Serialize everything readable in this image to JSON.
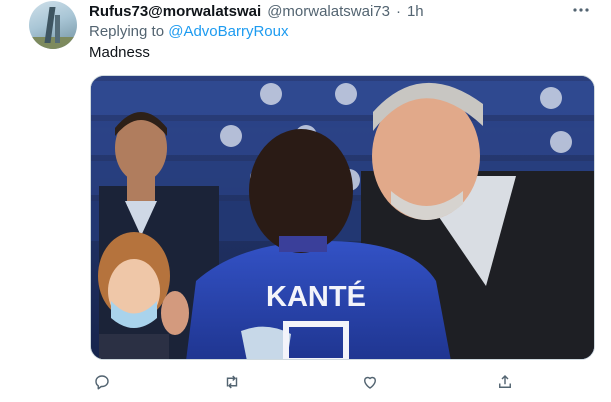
{
  "tweet": {
    "display_name": "Rufus73@morwalatswai",
    "handle": "@morwalatswai73",
    "separator": "·",
    "time": "1h",
    "replying_prefix": "Replying to",
    "replying_to": "@AdvoBarryRoux",
    "text": "Madness",
    "media_jersey_name": "KANTÉ"
  },
  "icons": {
    "more": "more-options-icon",
    "reply": "reply-icon",
    "retweet": "retweet-icon",
    "like": "like-icon",
    "share": "share-icon"
  },
  "colors": {
    "text_primary": "#0f1419",
    "text_secondary": "#536471",
    "link": "#1d9bf0",
    "border": "#cfd9de",
    "jersey_blue": "#2a45b3"
  }
}
